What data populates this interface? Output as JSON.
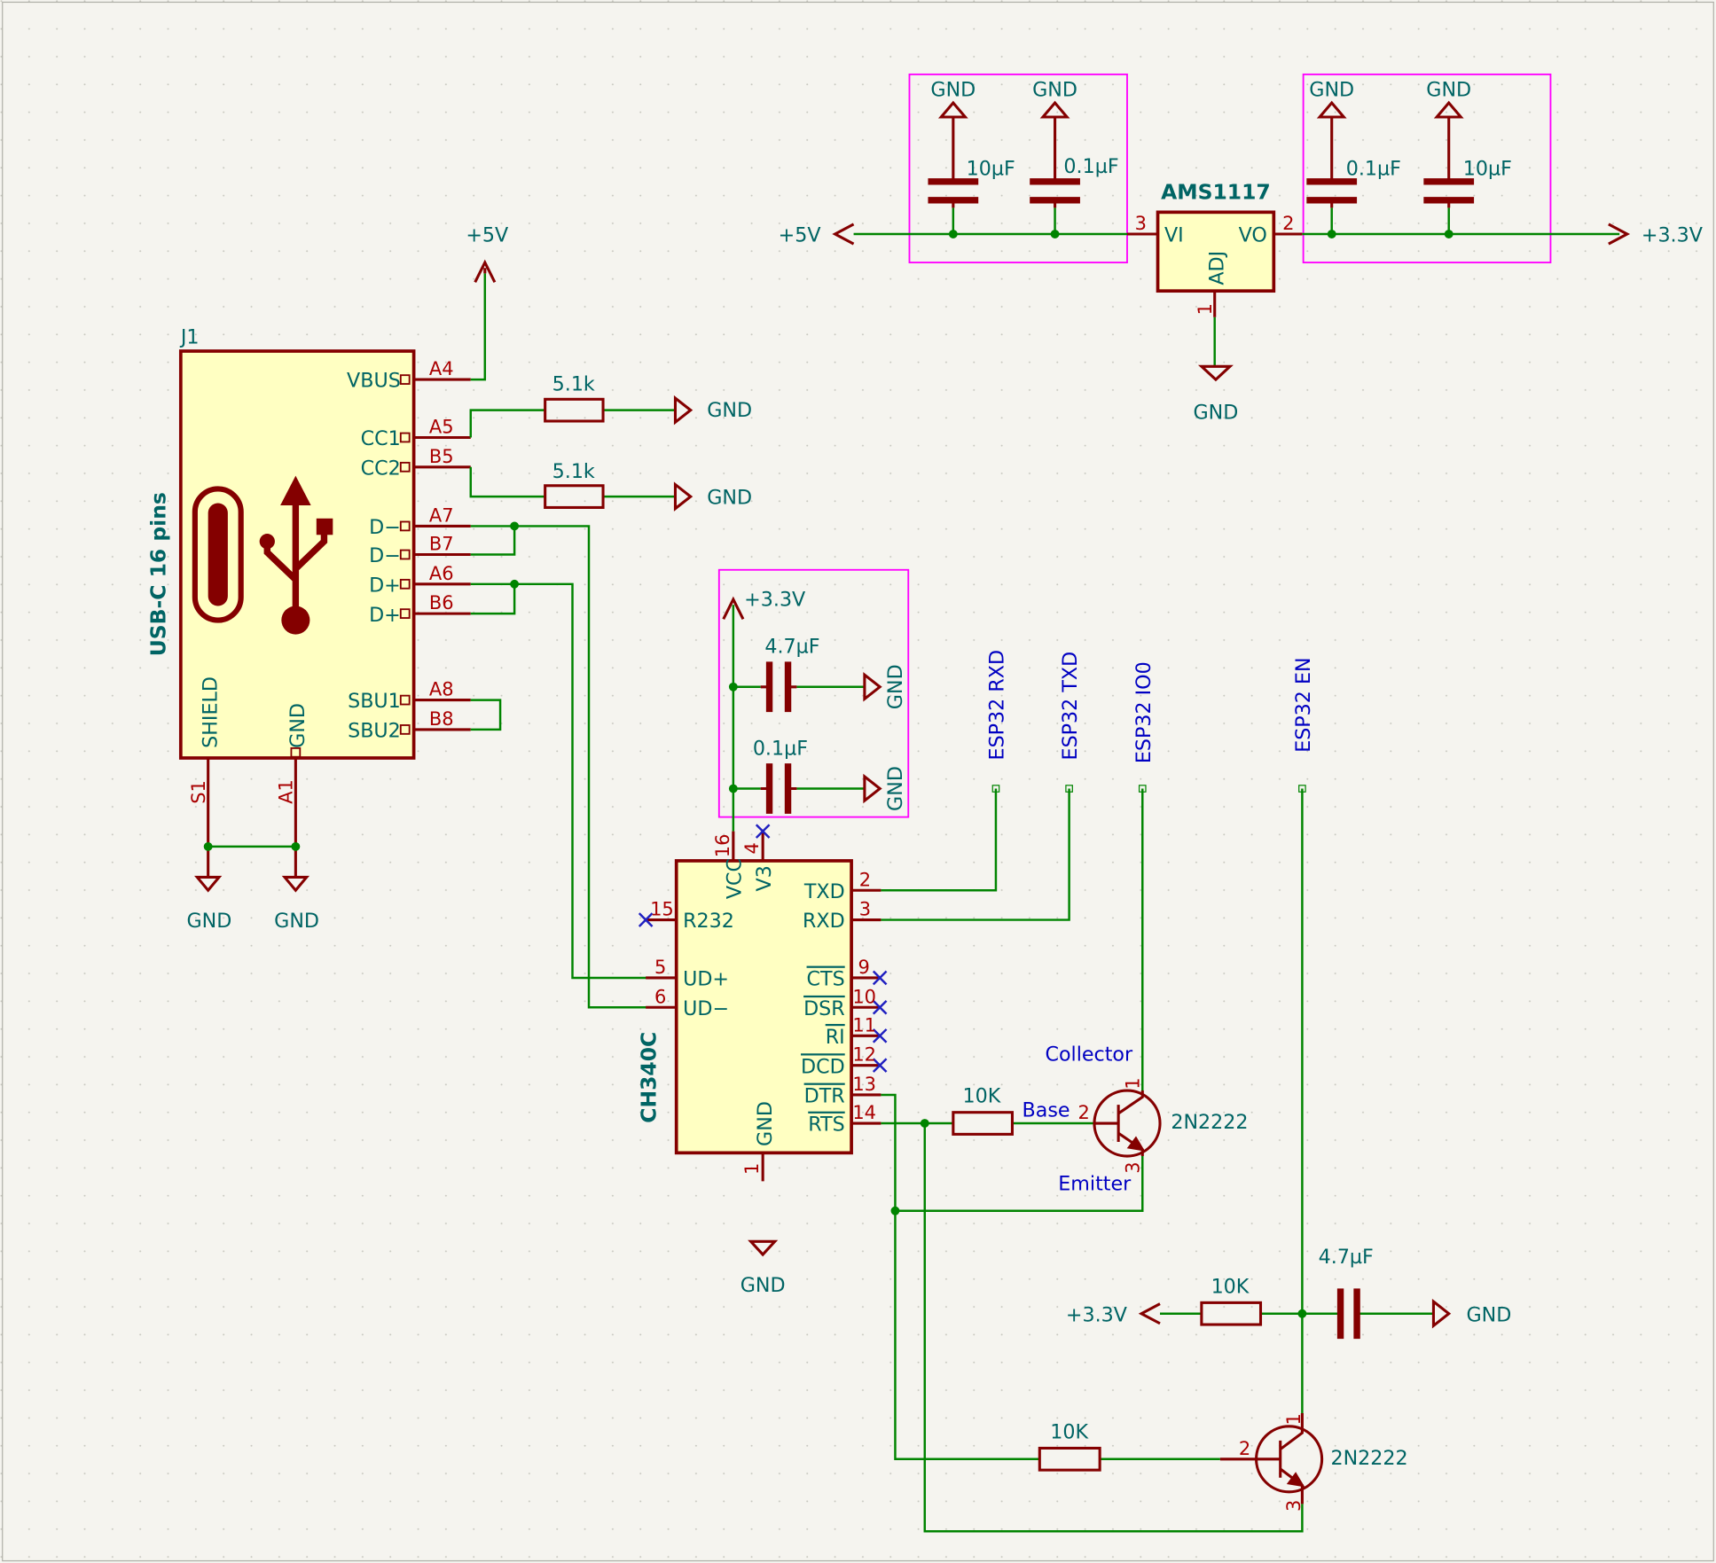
{
  "colors": {
    "wire": "#008400",
    "component": "#840000",
    "body_fill": "#ffffc2",
    "text": "#006464",
    "pin_number": "#a90000",
    "net_label": "#0000c2",
    "group_box": "#ff00ff",
    "background": "#f5f4ef"
  },
  "power": {
    "p5v": "+5V",
    "gnd": "GND",
    "p33v": "+3.3V"
  },
  "j1": {
    "ref": "J1",
    "value": "USB-C 16 pins",
    "icon": "usb-icon",
    "pins": [
      {
        "name": "VBUS",
        "num": "A4"
      },
      {
        "name": "CC1",
        "num": "A5"
      },
      {
        "name": "CC2",
        "num": "B5"
      },
      {
        "name": "D−",
        "num": "A7"
      },
      {
        "name": "D−",
        "num": "B7"
      },
      {
        "name": "D+",
        "num": "A6"
      },
      {
        "name": "D+",
        "num": "B6"
      },
      {
        "name": "SBU1",
        "num": "A8"
      },
      {
        "name": "SBU2",
        "num": "B8"
      },
      {
        "name": "SHIELD",
        "num": "S1"
      },
      {
        "name": "GND",
        "num": "A1"
      }
    ]
  },
  "resistors": {
    "cc": "5.1k",
    "base": "10K"
  },
  "caps": {
    "c10u": "10µF",
    "c100n": "0.1µF",
    "c47u": "4.7µF"
  },
  "regulator": {
    "value": "AMS1117",
    "vi": "VI",
    "vo": "VO",
    "adj": "ADJ",
    "vi_num": "3",
    "vo_num": "2",
    "adj_num": "1"
  },
  "ch340": {
    "value": "CH340C",
    "pins": [
      {
        "name": "VCC",
        "num": "16"
      },
      {
        "name": "V3",
        "num": "4"
      },
      {
        "name": "R232",
        "num": "15"
      },
      {
        "name": "TXD",
        "num": "2"
      },
      {
        "name": "RXD",
        "num": "3"
      },
      {
        "name": "UD+",
        "num": "5"
      },
      {
        "name": "UD−",
        "num": "6"
      },
      {
        "name": "CTS",
        "num": "9"
      },
      {
        "name": "DSR",
        "num": "10"
      },
      {
        "name": "RI",
        "num": "11"
      },
      {
        "name": "DCD",
        "num": "12"
      },
      {
        "name": "DTR",
        "num": "13"
      },
      {
        "name": "RTS",
        "num": "14"
      },
      {
        "name": "GND",
        "num": "1"
      }
    ]
  },
  "transistor": {
    "value": "2N2222",
    "collector": "Collector",
    "base": "Base",
    "emitter": "Emitter",
    "c_num": "1",
    "b_num": "2",
    "e_num": "3"
  },
  "nets": {
    "rxd": "ESP32 RXD",
    "txd": "ESP32 TXD",
    "io0": "ESP32 IO0",
    "en": "ESP32 EN"
  }
}
